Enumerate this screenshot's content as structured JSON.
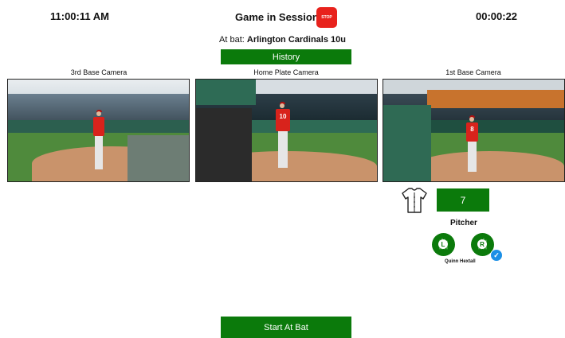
{
  "header": {
    "clock_time": "11:00:11 AM",
    "session_title": "Game in Session",
    "stop_label": "STOP",
    "elapsed_time": "00:00:22"
  },
  "at_bat": {
    "prefix": "At bat:",
    "team": "Arlington Cardinals 10u"
  },
  "buttons": {
    "history": "History",
    "start_at_bat": "Start At Bat"
  },
  "cameras": [
    {
      "label": "3rd Base Camera",
      "jersey": ""
    },
    {
      "label": "Home Plate Camera",
      "jersey": "10"
    },
    {
      "label": "1st Base Camera",
      "jersey": "8"
    }
  ],
  "pitcher": {
    "jersey_number": "7",
    "label": "Pitcher",
    "hand_left": "L",
    "hand_right": "R",
    "selected_hand": "R",
    "name": "Quinn Hextall"
  },
  "colors": {
    "accent_green": "#0b7a0b",
    "stop_red": "#e8221c",
    "check_blue": "#1b8fe6"
  },
  "icons": [
    "jersey-icon",
    "check-icon",
    "hand-icon"
  ]
}
